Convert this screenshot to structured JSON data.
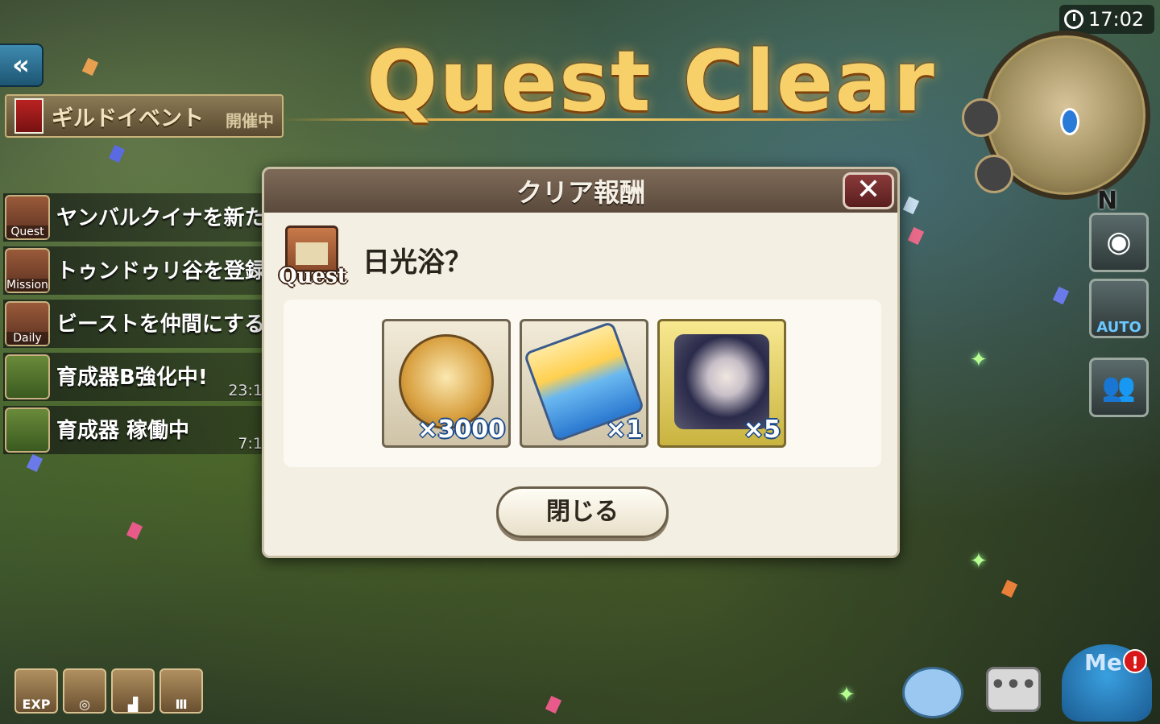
{
  "banner": {
    "title": "Quest Clear"
  },
  "clock": {
    "time": "17:02"
  },
  "minimap": {
    "compass": "N"
  },
  "guild_event": {
    "title": "ギルドイベント",
    "status": "開催中"
  },
  "tasks": [
    {
      "icon_label": "Quest",
      "text": "ヤンバルクイナを新た",
      "time": ""
    },
    {
      "icon_label": "Mission",
      "text": "トゥンドゥリ谷を登録",
      "time": ""
    },
    {
      "icon_label": "Daily",
      "text": "ビーストを仲間にする",
      "time": ""
    },
    {
      "icon_label": "",
      "text": "育成器B強化中!",
      "time": "23:1"
    },
    {
      "icon_label": "",
      "text": "育成器 稼働中",
      "time": "7:1"
    }
  ],
  "bottom_left": {
    "exp_label": "EXP"
  },
  "right_side": {
    "auto_label": "AUTO"
  },
  "bottom_right": {
    "chat_label": "•••",
    "menu_label": "Me",
    "alert": "!"
  },
  "dialog": {
    "title": "クリア報酬",
    "close_glyph": "✕",
    "quest_badge": "Quest",
    "quest_name": "日光浴？",
    "rewards": [
      {
        "name": "coin-medal",
        "quantity": "×3000"
      },
      {
        "name": "sun-ticket",
        "quantity": "×1"
      },
      {
        "name": "character-card",
        "quantity": "×5"
      }
    ],
    "close_button": "閉じる"
  },
  "colors": {
    "title_gold": "#f7d06a",
    "dialog_bg": "#f3efe2",
    "header_brown": "#6e5c4c",
    "close_red": "#7a2e2e"
  }
}
